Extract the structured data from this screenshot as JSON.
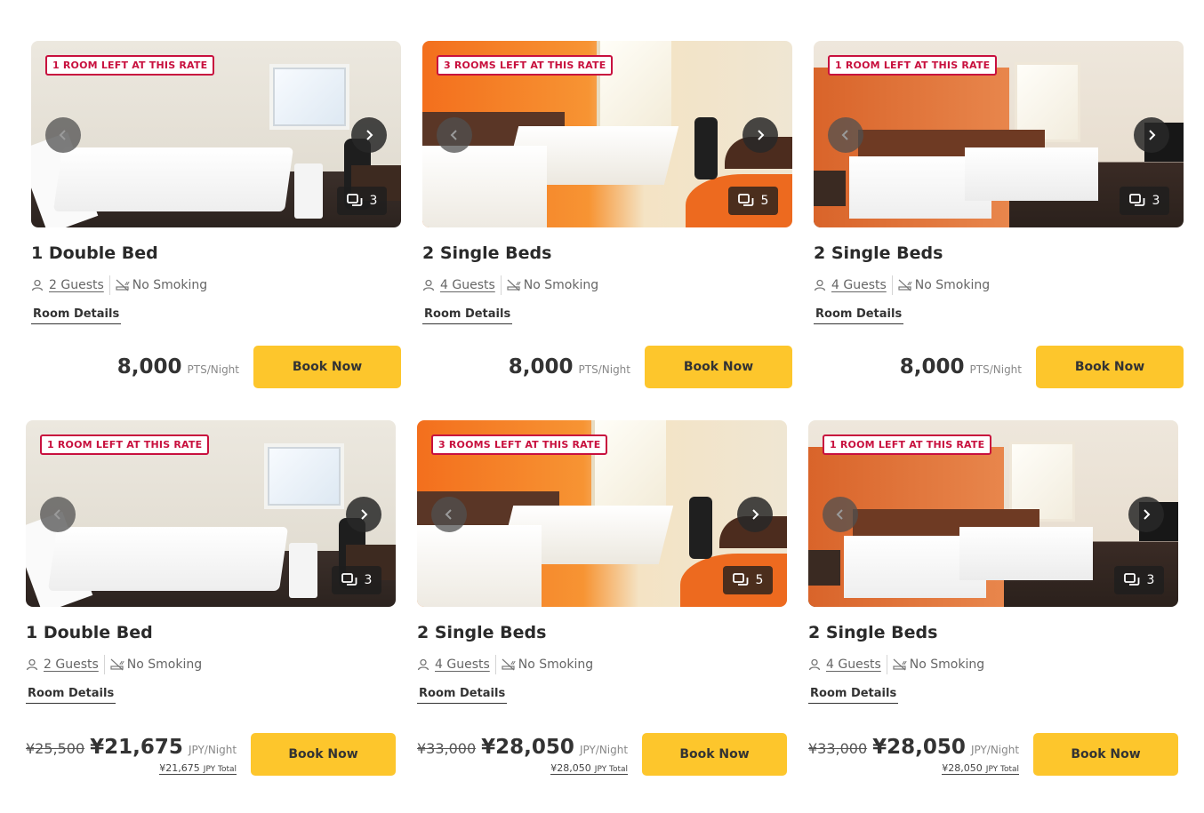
{
  "rooms": [
    {
      "badge": "1 ROOM LEFT AT THIS RATE",
      "photo_count": "3",
      "scene": "double",
      "title": "1 Double Bed",
      "guests": "2 Guests",
      "smoking": "No Smoking",
      "details": "Room Details",
      "price_pts": "8,000",
      "pts_unit": "PTS/Night",
      "book": "Book Now"
    },
    {
      "badge": "3 ROOMS LEFT AT THIS RATE",
      "photo_count": "5",
      "scene": "orange",
      "title": "2 Single Beds",
      "guests": "4 Guests",
      "smoking": "No Smoking",
      "details": "Room Details",
      "price_pts": "8,000",
      "pts_unit": "PTS/Night",
      "book": "Book Now"
    },
    {
      "badge": "1 ROOM LEFT AT THIS RATE",
      "photo_count": "3",
      "scene": "beige",
      "title": "2 Single Beds",
      "guests": "4 Guests",
      "smoking": "No Smoking",
      "details": "Room Details",
      "price_pts": "8,000",
      "pts_unit": "PTS/Night",
      "book": "Book Now"
    },
    {
      "badge": "1 ROOM LEFT AT THIS RATE",
      "photo_count": "3",
      "scene": "double",
      "title": "1 Double Bed",
      "guests": "2 Guests",
      "smoking": "No Smoking",
      "details": "Room Details",
      "old_price": "¥25,500",
      "new_price": "¥21,675",
      "jpy_unit": "JPY/Night",
      "total": "¥21,675",
      "total_label": "JPY Total",
      "book": "Book Now"
    },
    {
      "badge": "3 ROOMS LEFT AT THIS RATE",
      "photo_count": "5",
      "scene": "orange",
      "title": "2 Single Beds",
      "guests": "4 Guests",
      "smoking": "No Smoking",
      "details": "Room Details",
      "old_price": "¥33,000",
      "new_price": "¥28,050",
      "jpy_unit": "JPY/Night",
      "total": "¥28,050",
      "total_label": "JPY Total",
      "book": "Book Now"
    },
    {
      "badge": "1 ROOM LEFT AT THIS RATE",
      "photo_count": "3",
      "scene": "beige",
      "title": "2 Single Beds",
      "guests": "4 Guests",
      "smoking": "No Smoking",
      "details": "Room Details",
      "old_price": "¥33,000",
      "new_price": "¥28,050",
      "jpy_unit": "JPY/Night",
      "total": "¥28,050",
      "total_label": "JPY Total",
      "book": "Book Now"
    }
  ],
  "colors": {
    "accent": "#fdc62c",
    "badge": "#c8103e"
  }
}
